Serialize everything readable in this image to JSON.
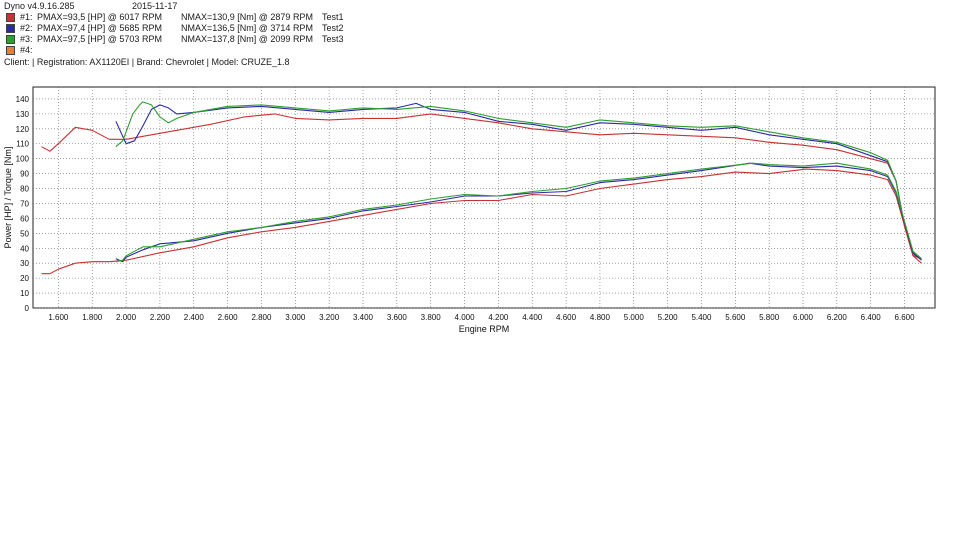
{
  "header": {
    "app_version": "Dyno v4.9.16.285",
    "date": "2015-11-17",
    "runs": [
      {
        "id": "#1:",
        "pmax": "PMAX=93,5 [HP] @ 6017 RPM",
        "nmax": "NMAX=130,9 [Nm] @ 2879 RPM",
        "test": "Test1",
        "color": "#c83232"
      },
      {
        "id": "#2:",
        "pmax": "PMAX=97,4 [HP] @ 5685 RPM",
        "nmax": "NMAX=136,5 [Nm] @ 3714 RPM",
        "test": "Test2",
        "color": "#2a2aa8"
      },
      {
        "id": "#3:",
        "pmax": "PMAX=97,5 [HP] @ 5703 RPM",
        "nmax": "NMAX=137,8 [Nm] @ 2099 RPM",
        "test": "Test3",
        "color": "#2f9e2f"
      },
      {
        "id": "#4:",
        "pmax": "",
        "nmax": "",
        "test": "",
        "color": "#e08040"
      }
    ],
    "client_line": "Client:  | Registration:  AX1120EI | Brand:  Chevrolet | Model:  CRUZE_1.8"
  },
  "chart_data": {
    "type": "line",
    "xlabel": "Engine RPM",
    "ylabel": "Power [HP] / Torque [Nm]",
    "xlim": [
      1450,
      6780
    ],
    "ylim": [
      0,
      148
    ],
    "x_ticks": [
      "1.600",
      "1.800",
      "2.000",
      "2.200",
      "2.400",
      "2.600",
      "2.800",
      "3.000",
      "3.200",
      "3.400",
      "3.600",
      "3.800",
      "4.000",
      "4.200",
      "4.400",
      "4.600",
      "4.800",
      "5.000",
      "5.200",
      "5.400",
      "5.600",
      "5.800",
      "6.000",
      "6.200",
      "6.400",
      "6.600"
    ],
    "x_tick_values": [
      1600,
      1800,
      2000,
      2200,
      2400,
      2600,
      2800,
      3000,
      3200,
      3400,
      3600,
      3800,
      4000,
      4200,
      4400,
      4600,
      4800,
      5000,
      5200,
      5400,
      5600,
      5800,
      6000,
      6200,
      6400,
      6600
    ],
    "y_ticks": [
      "0",
      "10",
      "20",
      "30",
      "40",
      "50",
      "60",
      "70",
      "80",
      "90",
      "100",
      "110",
      "120",
      "130",
      "140"
    ],
    "y_tick_values": [
      0,
      10,
      20,
      30,
      40,
      50,
      60,
      70,
      80,
      90,
      100,
      110,
      120,
      130,
      140
    ],
    "grid": true,
    "series": [
      {
        "name": "Test1",
        "quantity": "Torque [Nm]",
        "color": "#c83232",
        "x": [
          1500,
          1550,
          1600,
          1700,
          1800,
          1900,
          2000,
          2100,
          2300,
          2500,
          2700,
          2879,
          3000,
          3200,
          3400,
          3600,
          3800,
          4000,
          4200,
          4400,
          4600,
          4800,
          5000,
          5200,
          5400,
          5600,
          5800,
          6000,
          6200,
          6400,
          6500,
          6550,
          6600,
          6650,
          6700
        ],
        "y": [
          108,
          105,
          110,
          121,
          119,
          113,
          113,
          115,
          119,
          123,
          128,
          130,
          127,
          126,
          127,
          127,
          130,
          127,
          124,
          120,
          118,
          116,
          117,
          116,
          115,
          114,
          111,
          109,
          106,
          100,
          97,
          85,
          55,
          35,
          33
        ]
      },
      {
        "name": "Test2",
        "quantity": "Torque [Nm]",
        "color": "#2a2aa8",
        "x": [
          1940,
          1980,
          2000,
          2050,
          2100,
          2150,
          2200,
          2250,
          2300,
          2400,
          2600,
          2800,
          3000,
          3200,
          3400,
          3600,
          3714,
          3800,
          4000,
          4200,
          4400,
          4600,
          4800,
          5000,
          5200,
          5400,
          5600,
          5800,
          6000,
          6200,
          6400,
          6500,
          6550,
          6600,
          6650,
          6700
        ],
        "y": [
          125,
          115,
          110,
          112,
          122,
          133,
          136,
          134,
          130,
          131,
          134,
          135,
          133,
          131,
          133,
          134,
          137,
          133,
          131,
          125,
          123,
          119,
          124,
          123,
          121,
          119,
          121,
          116,
          113,
          110,
          102,
          98,
          85,
          55,
          36,
          33
        ]
      },
      {
        "name": "Test3",
        "quantity": "Torque [Nm]",
        "color": "#2f9e2f",
        "x": [
          1940,
          1980,
          2000,
          2040,
          2080,
          2099,
          2150,
          2200,
          2250,
          2300,
          2400,
          2600,
          2800,
          3000,
          3200,
          3400,
          3600,
          3800,
          4000,
          4200,
          4400,
          4600,
          4800,
          5000,
          5200,
          5400,
          5600,
          5800,
          6000,
          6200,
          6400,
          6500,
          6550,
          6600,
          6650,
          6700
        ],
        "y": [
          108,
          112,
          118,
          130,
          136,
          138,
          136,
          128,
          124,
          127,
          131,
          135,
          136,
          134,
          132,
          134,
          133,
          135,
          132,
          127,
          124,
          121,
          126,
          124,
          122,
          121,
          122,
          118,
          114,
          111,
          104,
          99,
          85,
          55,
          36,
          33
        ]
      },
      {
        "name": "Test1",
        "quantity": "Power [HP]",
        "color": "#c83232",
        "x": [
          1500,
          1550,
          1600,
          1700,
          1800,
          1900,
          2000,
          2200,
          2400,
          2600,
          2800,
          3000,
          3200,
          3400,
          3600,
          3800,
          4000,
          4200,
          4400,
          4600,
          4800,
          5000,
          5200,
          5400,
          5600,
          5800,
          6017,
          6200,
          6400,
          6500,
          6550,
          6600,
          6650,
          6700
        ],
        "y": [
          23,
          23,
          26,
          30,
          31,
          31,
          32,
          37,
          41,
          47,
          51,
          54,
          58,
          62,
          66,
          70,
          72,
          72,
          76,
          75,
          80,
          83,
          86,
          88,
          91,
          90,
          93,
          92,
          89,
          86,
          75,
          55,
          35,
          30
        ]
      },
      {
        "name": "Test2",
        "quantity": "Power [HP]",
        "color": "#2a2aa8",
        "x": [
          1940,
          1980,
          2000,
          2100,
          2200,
          2400,
          2600,
          2800,
          3000,
          3200,
          3400,
          3600,
          3800,
          4000,
          4200,
          4400,
          4600,
          4800,
          5000,
          5200,
          5400,
          5685,
          5800,
          6000,
          6200,
          6400,
          6500,
          6550,
          6600,
          6650,
          6700
        ],
        "y": [
          33,
          31,
          34,
          39,
          43,
          45,
          50,
          54,
          57,
          60,
          65,
          68,
          71,
          75,
          75,
          77,
          78,
          84,
          86,
          89,
          92,
          97,
          95,
          94,
          95,
          92,
          88,
          77,
          57,
          37,
          32
        ]
      },
      {
        "name": "Test3",
        "quantity": "Power [HP]",
        "color": "#2f9e2f",
        "x": [
          1940,
          1980,
          2000,
          2100,
          2200,
          2400,
          2600,
          2800,
          3000,
          3200,
          3400,
          3600,
          3800,
          4000,
          4200,
          4400,
          4600,
          4800,
          5000,
          5200,
          5400,
          5703,
          5800,
          6000,
          6200,
          6400,
          6500,
          6550,
          6600,
          6650,
          6700
        ],
        "y": [
          31,
          32,
          35,
          41,
          41,
          46,
          51,
          54,
          58,
          61,
          66,
          69,
          73,
          76,
          75,
          78,
          80,
          85,
          87,
          90,
          93,
          97,
          96,
          95,
          97,
          93,
          89,
          78,
          58,
          38,
          33
        ]
      }
    ]
  }
}
